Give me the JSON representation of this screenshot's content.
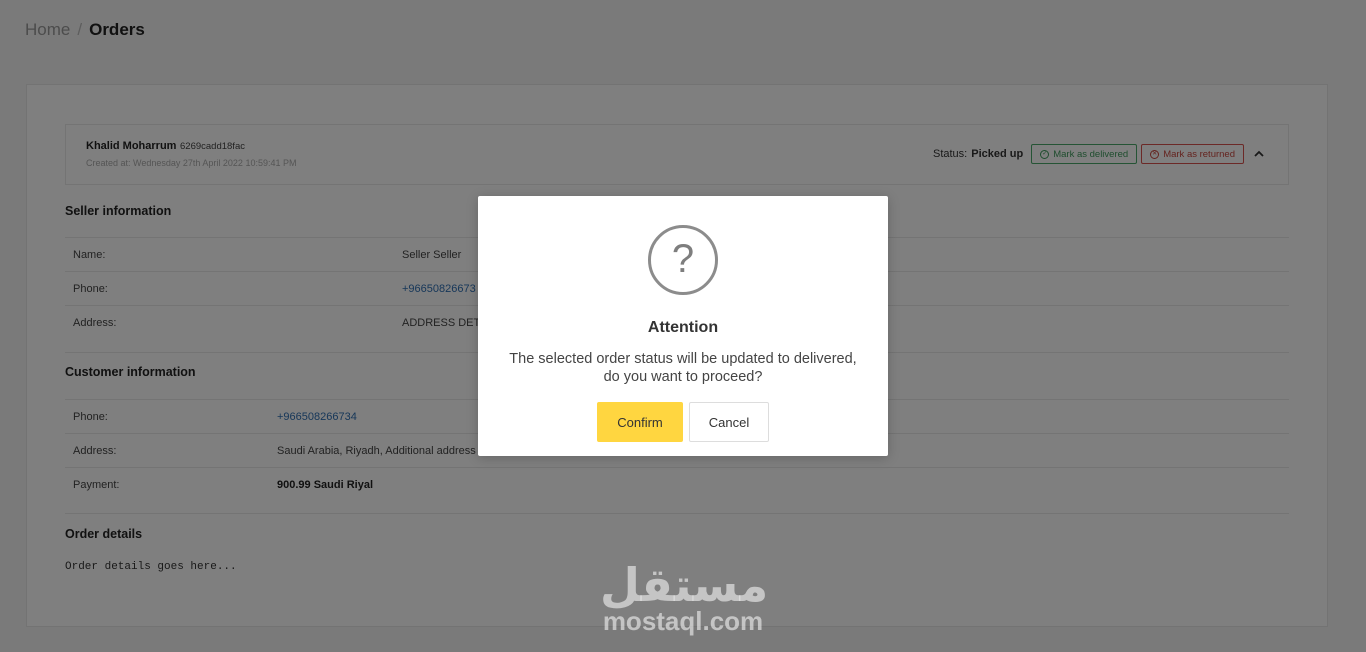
{
  "breadcrumb": {
    "home": "Home",
    "separator": "/",
    "current": "Orders"
  },
  "order": {
    "customer_name": "Khalid Moharrum",
    "order_id": "6269cadd18fac",
    "created_at": "Created at: Wednesday 27th April 2022 10:59:41 PM",
    "status_label": "Status:",
    "status_value": "Picked up",
    "mark_delivered": "Mark as delivered",
    "mark_returned": "Mark as returned"
  },
  "seller": {
    "title": "Seller information",
    "rows": [
      {
        "label": "Name:",
        "value": "Seller Seller"
      },
      {
        "label": "Phone:",
        "value": "+96650826673"
      },
      {
        "label": "Address:",
        "value": "ADDRESS DETA"
      }
    ]
  },
  "customer": {
    "title": "Customer information",
    "rows": [
      {
        "label": "Phone:",
        "value": "+966508266734"
      },
      {
        "label": "Address:",
        "value": "Saudi Arabia, Riyadh, Additional address"
      },
      {
        "label": "Payment:",
        "value": "900.99 Saudi Riyal"
      }
    ]
  },
  "details": {
    "title": "Order details",
    "text": "Order details goes here..."
  },
  "modal": {
    "icon": "?",
    "title": "Attention",
    "message_line1": "The selected order status will be updated to delivered,",
    "message_line2": "do you want to proceed?",
    "confirm": "Confirm",
    "cancel": "Cancel"
  },
  "watermark": {
    "arabic": "مستقل",
    "latin": "mostaql.com"
  },
  "colors": {
    "confirm_bg": "#ffd640",
    "delivered": "#3f9a5d",
    "returned": "#c9483f",
    "link": "#2f6fb3"
  }
}
